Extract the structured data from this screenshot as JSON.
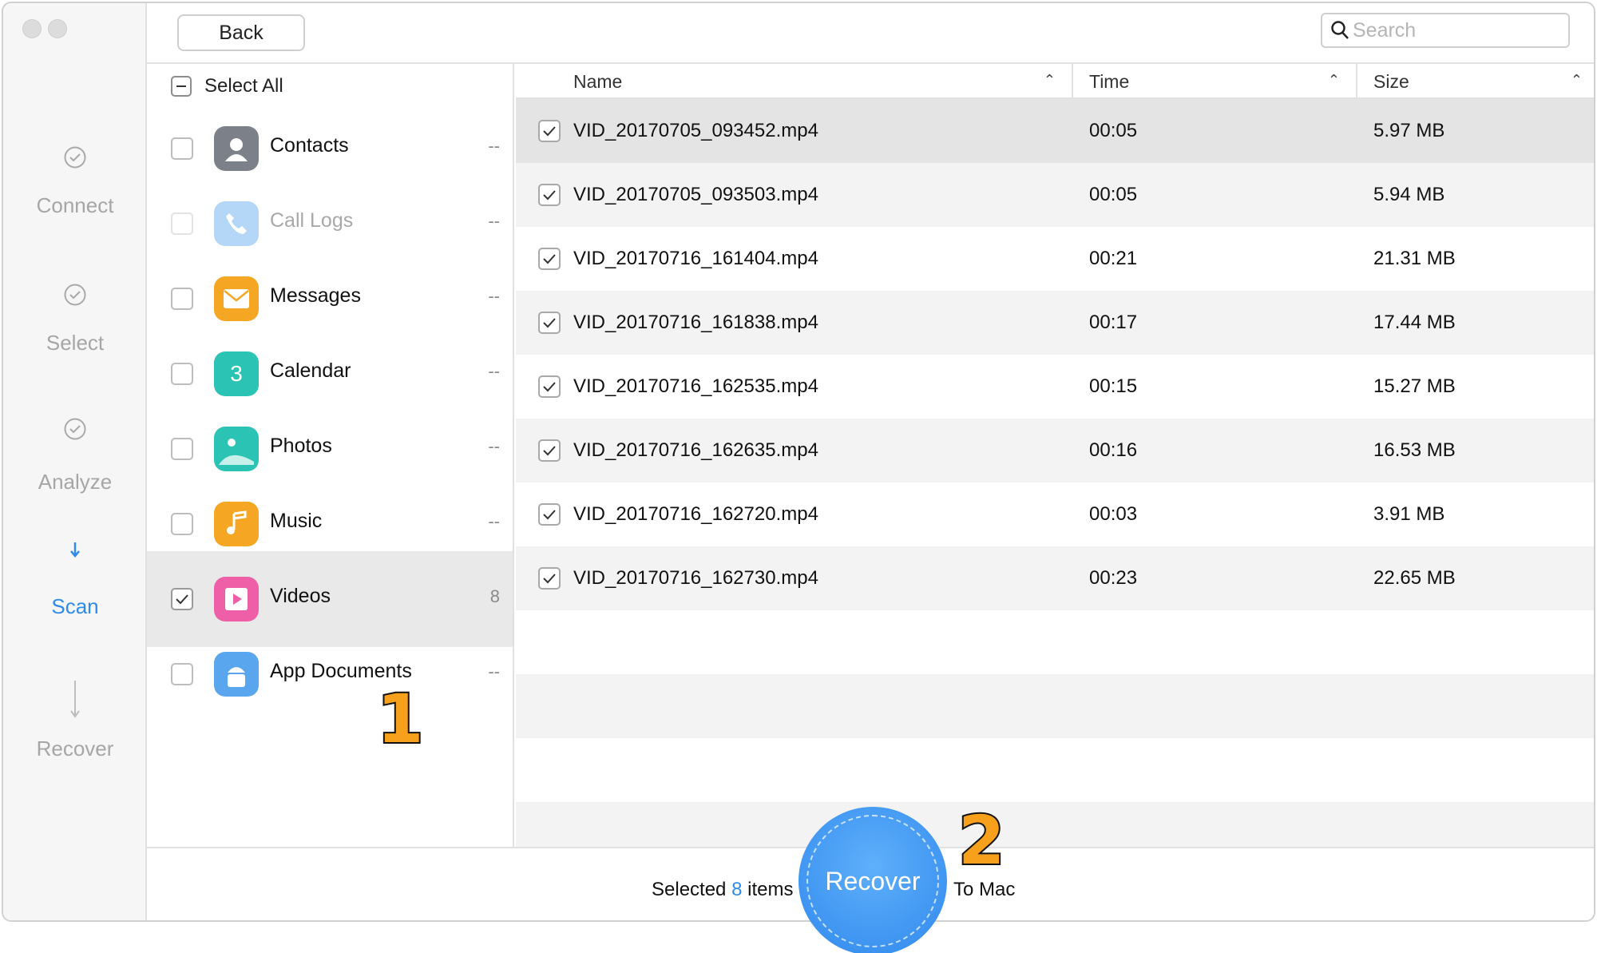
{
  "back_label": "Back",
  "search_placeholder": "Search",
  "steps": [
    {
      "label": "Connect",
      "state": "done"
    },
    {
      "label": "Select",
      "state": "done"
    },
    {
      "label": "Analyze",
      "state": "done"
    },
    {
      "label": "Scan",
      "state": "active"
    },
    {
      "label": "Recover",
      "state": "pending"
    }
  ],
  "select_all_label": "Select All",
  "categories": [
    {
      "name": "Contacts",
      "count": "--",
      "checked": false,
      "disabled": false,
      "icon": "contacts-icon",
      "color": "#7b8089"
    },
    {
      "name": "Call Logs",
      "count": "--",
      "checked": false,
      "disabled": true,
      "icon": "phone-icon",
      "color": "#8fc2f5"
    },
    {
      "name": "Messages",
      "count": "--",
      "checked": false,
      "disabled": false,
      "icon": "envelope-icon",
      "color": "#f5a623"
    },
    {
      "name": "Calendar",
      "count": "--",
      "checked": false,
      "disabled": false,
      "icon": "calendar-icon",
      "color": "#2bc3b4",
      "icon_text": "3"
    },
    {
      "name": "Photos",
      "count": "--",
      "checked": false,
      "disabled": false,
      "icon": "photos-icon",
      "color": "#2bc3b4"
    },
    {
      "name": "Music",
      "count": "--",
      "checked": false,
      "disabled": false,
      "icon": "music-note-icon",
      "color": "#f5a623"
    },
    {
      "name": "Videos",
      "count": "8",
      "checked": true,
      "disabled": false,
      "selected": true,
      "icon": "video-play-icon",
      "color": "#ef5fa7"
    },
    {
      "name": "App Documents",
      "count": "--",
      "checked": false,
      "disabled": false,
      "icon": "android-icon",
      "color": "#5aa6ee"
    }
  ],
  "columns": {
    "name": "Name",
    "time": "Time",
    "size": "Size"
  },
  "files": [
    {
      "name": "VID_20170705_093452.mp4",
      "time": "00:05",
      "size": "5.97 MB",
      "checked": true
    },
    {
      "name": "VID_20170705_093503.mp4",
      "time": "00:05",
      "size": "5.94 MB",
      "checked": true
    },
    {
      "name": "VID_20170716_161404.mp4",
      "time": "00:21",
      "size": "21.31 MB",
      "checked": true
    },
    {
      "name": "VID_20170716_161838.mp4",
      "time": "00:17",
      "size": "17.44 MB",
      "checked": true
    },
    {
      "name": "VID_20170716_162535.mp4",
      "time": "00:15",
      "size": "15.27 MB",
      "checked": true
    },
    {
      "name": "VID_20170716_162635.mp4",
      "time": "00:16",
      "size": "16.53 MB",
      "checked": true
    },
    {
      "name": "VID_20170716_162720.mp4",
      "time": "00:03",
      "size": "3.91 MB",
      "checked": true
    },
    {
      "name": "VID_20170716_162730.mp4",
      "time": "00:23",
      "size": "22.65 MB",
      "checked": true
    }
  ],
  "footer": {
    "selected_prefix": "Selected",
    "selected_count": "8",
    "selected_suffix": "items",
    "destination": "To Mac"
  },
  "recover_label": "Recover",
  "annotations": [
    "1",
    "2"
  ],
  "colors": {
    "accent": "#2f8be8",
    "badge": "#f7a01c"
  }
}
